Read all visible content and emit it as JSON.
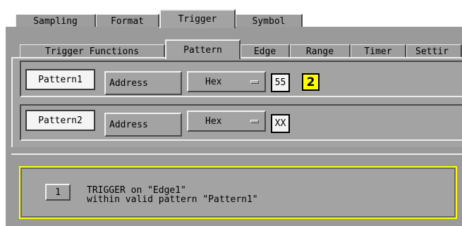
{
  "tabs": [
    {
      "label": "Sampling"
    },
    {
      "label": "Format"
    },
    {
      "label": "Trigger",
      "active": true
    },
    {
      "label": "Symbol"
    }
  ],
  "subtabs": [
    {
      "label": "Trigger Functions"
    },
    {
      "label": "Pattern",
      "active": true
    },
    {
      "label": "Edge"
    },
    {
      "label": "Range"
    },
    {
      "label": "Timer"
    },
    {
      "label": "Settir"
    }
  ],
  "patterns": [
    {
      "name": "Pattern1",
      "field": "Address",
      "base": "Hex",
      "value": "55",
      "badge": "2"
    },
    {
      "name": "Pattern2",
      "field": "Address",
      "base": "Hex",
      "value": "XX"
    }
  ],
  "sequence": {
    "step": "1",
    "line1": "TRIGGER on \"Edge1\"",
    "line2": "within valid pattern \"Pattern1\""
  },
  "colors": {
    "highlight": "#ffff00",
    "panel": "#a3a3a3"
  }
}
